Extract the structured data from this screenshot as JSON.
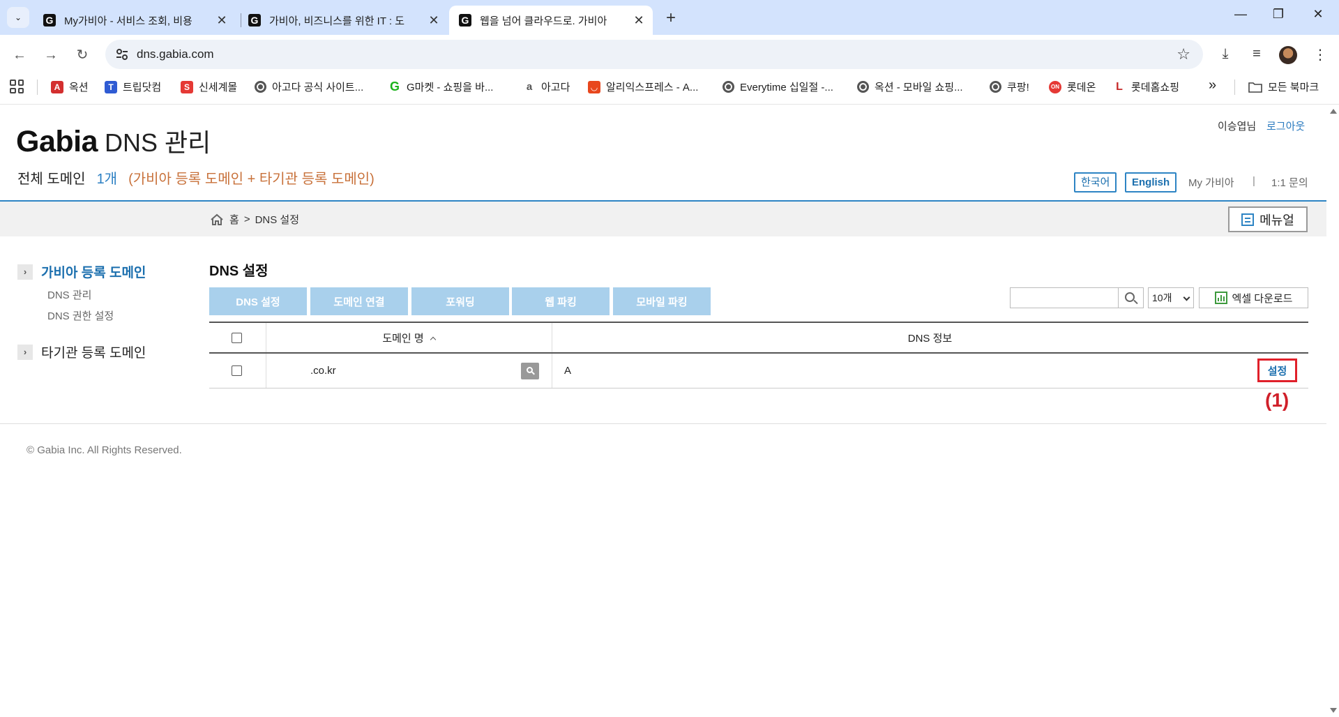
{
  "browser": {
    "tabs": [
      {
        "title": "My가비아 - 서비스 조회, 비용",
        "active": false
      },
      {
        "title": "가비아, 비즈니스를 위한 IT : 도",
        "active": false
      },
      {
        "title": "웹을 넘어 클라우드로. 가비아",
        "active": true
      }
    ],
    "favicon_letter": "G",
    "new_tab_symbol": "+",
    "tab_search_symbol": "⌄",
    "close_symbol": "✕",
    "window_controls": {
      "minimize": "—",
      "restore": "❐",
      "close": "✕"
    },
    "nav": {
      "back": "←",
      "forward": "→",
      "reload": "↻"
    },
    "url": "dns.gabia.com",
    "star_symbol": "☆",
    "toolbar_icons": {
      "download": "⤓",
      "media": "≡",
      "menu": "⋮"
    },
    "bookmarks": [
      {
        "label": "옥션",
        "icon_letter": "A",
        "color": "#d32f2f",
        "type": "letter"
      },
      {
        "label": "트립닷컴",
        "icon_letter": "T",
        "color": "#2f5bd3",
        "type": "letter"
      },
      {
        "label": "신세계몰",
        "icon_letter": "S",
        "color": "#e53935",
        "type": "letter"
      },
      {
        "label": "아고다 공식 사이트...",
        "type": "globe"
      },
      {
        "label": "G마켓 - 쇼핑을 바...",
        "icon_letter": "G",
        "color": "#1bb21b",
        "type": "letter"
      },
      {
        "label": "아고다",
        "icon_letter": "a",
        "color": "#888888",
        "type": "letter"
      },
      {
        "label": "알리익스프레스 - A...",
        "icon_letter": "◡",
        "color": "#e8471d",
        "type": "letter"
      },
      {
        "label": "Everytime 십일절 -...",
        "type": "globe"
      },
      {
        "label": "옥션 - 모바일 쇼핑...",
        "type": "globe"
      },
      {
        "label": "쿠팡!",
        "type": "globe"
      },
      {
        "label": "롯데온",
        "icon_letter": "ON",
        "color": "#e53935",
        "type": "letter"
      },
      {
        "label": "롯데홈쇼핑",
        "icon_letter": "L",
        "color": "#c62828",
        "type": "letter"
      }
    ],
    "bookmarks_more": "»",
    "all_bookmarks": "모든 북마크"
  },
  "header": {
    "brand": "Gabia",
    "brand_sub": "DNS 관리",
    "summary_label": "전체 도메인",
    "summary_count": "1개",
    "summary_desc": "(가비아 등록 도메인 + 타기관 등록 도메인)",
    "username": "이승엽님",
    "logout": "로그아웃",
    "lang_ko": "한국어",
    "lang_en": "English",
    "my_gabia": "My 가비아",
    "separator": "|",
    "inquiry": "1:1 문의"
  },
  "breadcrumb": {
    "home": "홈",
    "separator": ">",
    "current": "DNS 설정"
  },
  "manual_button": "메뉴얼",
  "sidebar": {
    "groups": [
      {
        "label": "가비아 등록 도메인",
        "arrow": "›",
        "active": true,
        "items": [
          "DNS 관리",
          "DNS 권한 설정"
        ]
      },
      {
        "label": "타기관 등록 도메인",
        "arrow": "›",
        "active": false,
        "items": []
      }
    ]
  },
  "main": {
    "title": "DNS 설정",
    "actions": [
      "DNS 설정",
      "도메인 연결",
      "포워딩",
      "웹 파킹",
      "모바일 파킹"
    ],
    "search_placeholder": "",
    "page_size": "10개",
    "excel_button": "엑셀 다운로드",
    "table": {
      "headers": {
        "domain": "도메인 명",
        "dns_info": "DNS 정보"
      },
      "rows": [
        {
          "domain": ".co.kr",
          "dns_info": "A",
          "action": "설정"
        }
      ]
    },
    "annotation": "(1)"
  },
  "footer": {
    "copyright": "© Gabia Inc. All Rights Reserved."
  },
  "colors": {
    "accent": "#2d84c4",
    "orange": "#c8713a",
    "action_disabled": "#a9d0ec",
    "highlight": "#e0202a"
  }
}
